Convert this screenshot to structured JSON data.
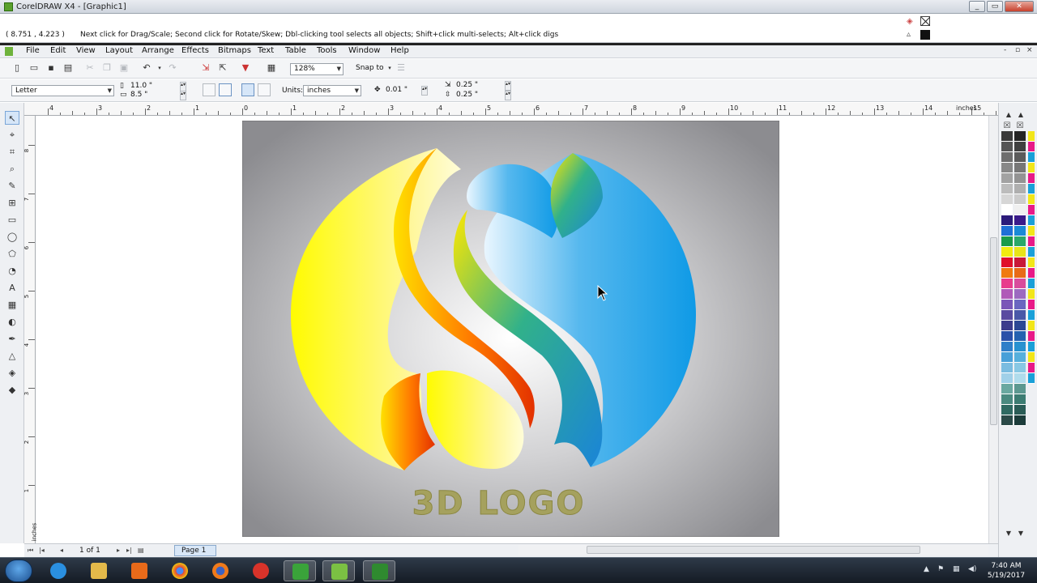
{
  "window": {
    "title": "CorelDRAW X4 - [Graphic1]",
    "minimize_label": "_",
    "restore_label": "▭",
    "close_label": "✕"
  },
  "hint": {
    "coordinates": "( 8.751 , 4.223 )",
    "message": "Next click for Drag/Scale; Second click for Rotate/Skew; Dbl-clicking tool selects all objects; Shift+click multi-selects; Alt+click digs"
  },
  "menu": {
    "items": [
      "File",
      "Edit",
      "View",
      "Layout",
      "Arrange",
      "Effects",
      "Bitmaps",
      "Text",
      "Table",
      "Tools",
      "Window",
      "Help"
    ],
    "doc_controls": [
      "-",
      "▫",
      "×"
    ]
  },
  "standard_toolbar": {
    "zoom": "128%",
    "snap_to": "Snap to"
  },
  "property_bar": {
    "paper_size": "Letter",
    "page_width": "11.0 \"",
    "page_height": "8.5 \"",
    "units_label": "Units:",
    "units": "inches",
    "nudge": "0.01 \"",
    "duplicate_x": "0.25 \"",
    "duplicate_y": "0.25 \""
  },
  "ruler": {
    "h_labels": [
      "4",
      "3",
      "2",
      "1",
      "0",
      "1",
      "2",
      "3",
      "4",
      "5",
      "6",
      "7",
      "8",
      "9",
      "10",
      "11",
      "12",
      "13",
      "14",
      "15"
    ],
    "unit": "inches",
    "v_labels": [
      "8",
      "7",
      "6",
      "5",
      "4",
      "3",
      "2",
      "1"
    ],
    "v_unit": "inches"
  },
  "canvas": {
    "logo_text": "3D LOGO"
  },
  "page_nav": {
    "page_count": "1 of 1",
    "page_tab": "Page 1"
  },
  "palette": {
    "col1": [
      "#3a3a3a",
      "#555555",
      "#6e6e6e",
      "#888888",
      "#a2a2a2",
      "#bcbcbc",
      "#d6d6d6",
      "#ffffff",
      "#2b1a7a",
      "#1f6fd6",
      "#1a9a4a",
      "#f2ec10",
      "#e0102a",
      "#f07a10",
      "#e83c8c",
      "#b05ab8",
      "#7a56b8",
      "#5a4aa0",
      "#3c3c8c",
      "#2a50a8",
      "#2f7fc8",
      "#48a0d8",
      "#7abce0",
      "#a0d0e8",
      "#6aa8a0",
      "#4a8a80",
      "#2f6a62",
      "#2b4a48"
    ],
    "col2": [
      "#242424",
      "#404040",
      "#5b5b5b",
      "#777777",
      "#939393",
      "#afafaf",
      "#cbcbcb",
      "#f0f0f0",
      "#3a1a8a",
      "#1a8ad6",
      "#2aa86a",
      "#e8e41a",
      "#c81838",
      "#e86a18",
      "#d84c9c",
      "#9c6ac0",
      "#6a66c0",
      "#4a58a8",
      "#2c4894",
      "#2462b0",
      "#2892d0",
      "#56b0dc",
      "#88c8e4",
      "#b0dcec",
      "#5c9890",
      "#3c7c72",
      "#2a5c56",
      "#1c3c3a"
    ],
    "col3": [
      "#f2e61a",
      "#e81a88",
      "#1aa0d8",
      "#f2e61a",
      "#e81a88",
      "#1aa0d8",
      "#f2e61a",
      "#e81a88",
      "#1aa0d8",
      "#f2e61a",
      "#e81a88",
      "#1aa0d8",
      "#f2e61a",
      "#e81a88",
      "#1aa0d8",
      "#f2e61a",
      "#e81a88",
      "#1aa0d8",
      "#f2e61a",
      "#e81a88",
      "#1aa0d8",
      "#f2e61a",
      "#e81a88",
      "#1aa0d8"
    ]
  },
  "taskbar": {
    "time": "7:40 AM",
    "date": "5/19/2017"
  }
}
